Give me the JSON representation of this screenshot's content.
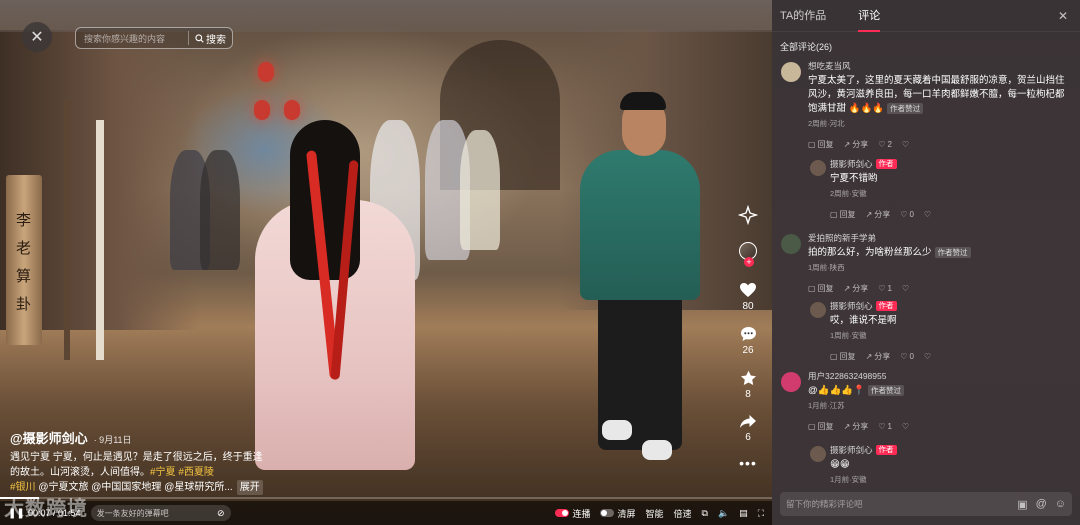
{
  "video": {
    "search_placeholder": "搜索你感兴趣的内容",
    "search_button": "搜索",
    "sign_chars": [
      "李",
      "老",
      "算",
      "卦"
    ],
    "author": "@摄影师剑心",
    "post_date": "· 9月11日",
    "desc_text": "遇见宁夏 宁夏，何止是遇见？是走了很远之后，终于重逢的故土。山河滚烫，人间值得。",
    "tags": [
      "#宁夏",
      "#西夏陵",
      "#银川"
    ],
    "mentions": [
      "@宁夏文旅",
      "@中国国家地理",
      "@星球研究所..."
    ],
    "expand_label": "展开",
    "actions": {
      "likes": "80",
      "comments": "26",
      "favorites": "8",
      "shares": "6"
    },
    "progress": 0.05,
    "time_current": "00:07",
    "time_total": "01:54",
    "danmu_placeholder": "发一条友好的弹幕吧",
    "ctrl": {
      "autoplay": "连播",
      "fullscreen_web": "清屏",
      "smart": "智能",
      "speed": "倍速"
    },
    "watermark": "大数跨境"
  },
  "panel": {
    "tabs": [
      "TA的作品",
      "评论"
    ],
    "active_tab": 1,
    "comment_count": "全部评论(26)",
    "input_placeholder": "留下你的精彩评论吧",
    "comments": [
      {
        "user": "想吃麦当风",
        "text": "宁夏太美了，这里的夏天藏着中国最舒服的凉意，贺兰山挡住风沙，黄河滋养良田，每一口羊肉都鲜嫩不膻，每一粒枸杞都饱满甘甜",
        "liked_tag": "作者赞过",
        "meta": "2周前·河北",
        "reply_label": "回复",
        "share_label": "分享",
        "likes": "2",
        "avatar_color": "#c9b79a"
      },
      {
        "user": "摄影师剑心",
        "is_author": true,
        "author_badge": "作者",
        "text": "宁夏不错哟",
        "meta": "2周前·安徽",
        "reply_label": "回复",
        "share_label": "分享",
        "likes": "0",
        "avatar_color": "#6b5a4d"
      },
      {
        "user": "爱拍照的新手学弟",
        "text": "拍的那么好，为啥粉丝那么少",
        "liked_tag": "作者赞过",
        "meta": "1周前·陕西",
        "reply_label": "回复",
        "share_label": "分享",
        "likes": "1",
        "avatar_color": "#4b5a46"
      },
      {
        "user": "摄影师剑心",
        "is_author": true,
        "author_badge": "作者",
        "text": "哎，谁说不是啊",
        "meta": "1周前·安徽",
        "reply_label": "回复",
        "share_label": "分享",
        "likes": "0",
        "avatar_color": "#6b5a4d"
      },
      {
        "user": "用户3228632498955",
        "text": "@👍👍👍📍",
        "liked_tag": "作者赞过",
        "meta": "1月前·江苏",
        "reply_label": "回复",
        "share_label": "分享",
        "likes": "1",
        "avatar_color": "#d23b6e"
      },
      {
        "user": "摄影师剑心",
        "is_author": true,
        "author_badge": "作者",
        "text": "😁😁",
        "meta": "1月前·安徽",
        "reply_label": "回复",
        "share_label": "分享",
        "likes": "0",
        "avatar_color": "#6b5a4d"
      }
    ]
  },
  "colors": {
    "accent": "#fe2c55",
    "tag": "#f4c542",
    "panel_bg": "#3c3437"
  }
}
